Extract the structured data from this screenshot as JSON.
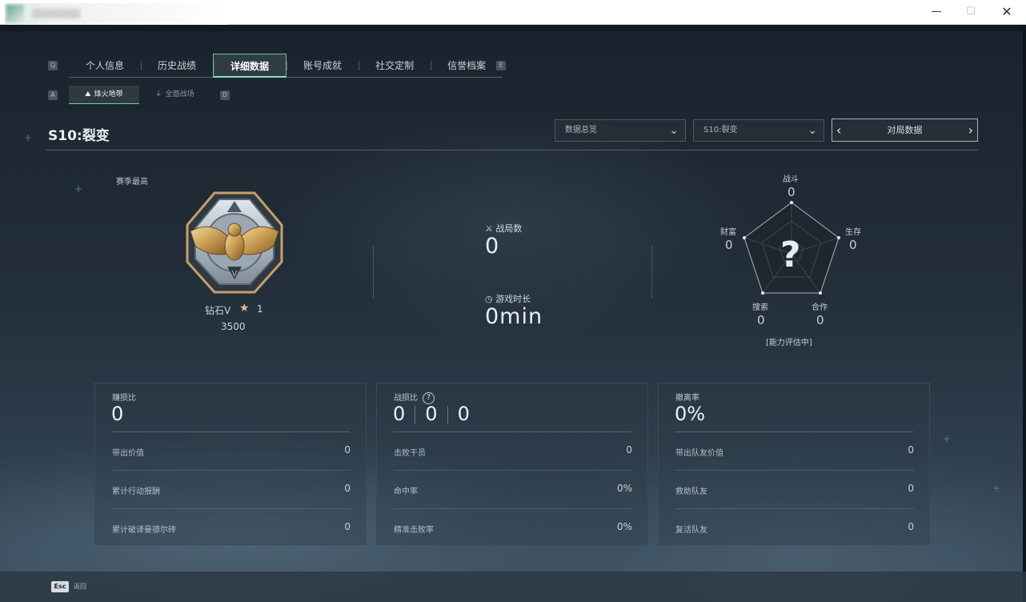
{
  "window": {
    "minimize_glyph": "—",
    "maximize_glyph": "☐",
    "close_glyph": "✕"
  },
  "tab_keys": {
    "left": "Q",
    "right": "E",
    "sub_left": "A",
    "sub_right": "D"
  },
  "tabs": [
    {
      "label": "个人信息",
      "active": false
    },
    {
      "label": "历史战绩",
      "active": false
    },
    {
      "label": "详细数据",
      "active": true
    },
    {
      "label": "账号成就",
      "active": false
    },
    {
      "label": "社交定制",
      "active": false
    },
    {
      "label": "信誉档案",
      "active": false
    }
  ],
  "subtabs": [
    {
      "label": "烽火地带",
      "icon": "warzone-icon",
      "active": true
    },
    {
      "label": "全面战场",
      "icon": "battlefield-icon",
      "active": false
    }
  ],
  "season": {
    "title": "S10:裂变"
  },
  "filters": {
    "overview": "数据总览",
    "season": "S10:裂变",
    "pager_label": "对局数据"
  },
  "rank": {
    "label": "赛季最高",
    "tier": "钻石V",
    "stars": "1",
    "score": "3500"
  },
  "summary": {
    "matches_label": "战局数",
    "matches_value": "0",
    "playtime_label": "游戏时长",
    "playtime_value": "0min"
  },
  "radar": {
    "center_mark": "?",
    "status": "[能力评估中]",
    "axes": [
      {
        "label": "战斗",
        "value": "0"
      },
      {
        "label": "生存",
        "value": "0"
      },
      {
        "label": "合作",
        "value": "0"
      },
      {
        "label": "搜索",
        "value": "0"
      },
      {
        "label": "财富",
        "value": "0"
      }
    ]
  },
  "panels": [
    {
      "head": "赚损比",
      "big": "0",
      "rows": [
        {
          "key": "带出价值",
          "value": "0"
        },
        {
          "key": "累计行动报酬",
          "value": "0"
        },
        {
          "key": "累计破译曼德尔砖",
          "value": "0"
        }
      ]
    },
    {
      "head": "战损比",
      "help": "?",
      "big_parts": [
        "0",
        "0",
        "0"
      ],
      "rows": [
        {
          "key": "击败干员",
          "value": "0"
        },
        {
          "key": "命中率",
          "value": "0%"
        },
        {
          "key": "精准击败率",
          "value": "0%"
        }
      ]
    },
    {
      "head": "撤离率",
      "big": "0%",
      "rows": [
        {
          "key": "带出队友价值",
          "value": "0"
        },
        {
          "key": "救助队友",
          "value": "0"
        },
        {
          "key": "复活队友",
          "value": "0"
        }
      ]
    }
  ],
  "footer": {
    "key": "Esc",
    "label": "返回"
  }
}
